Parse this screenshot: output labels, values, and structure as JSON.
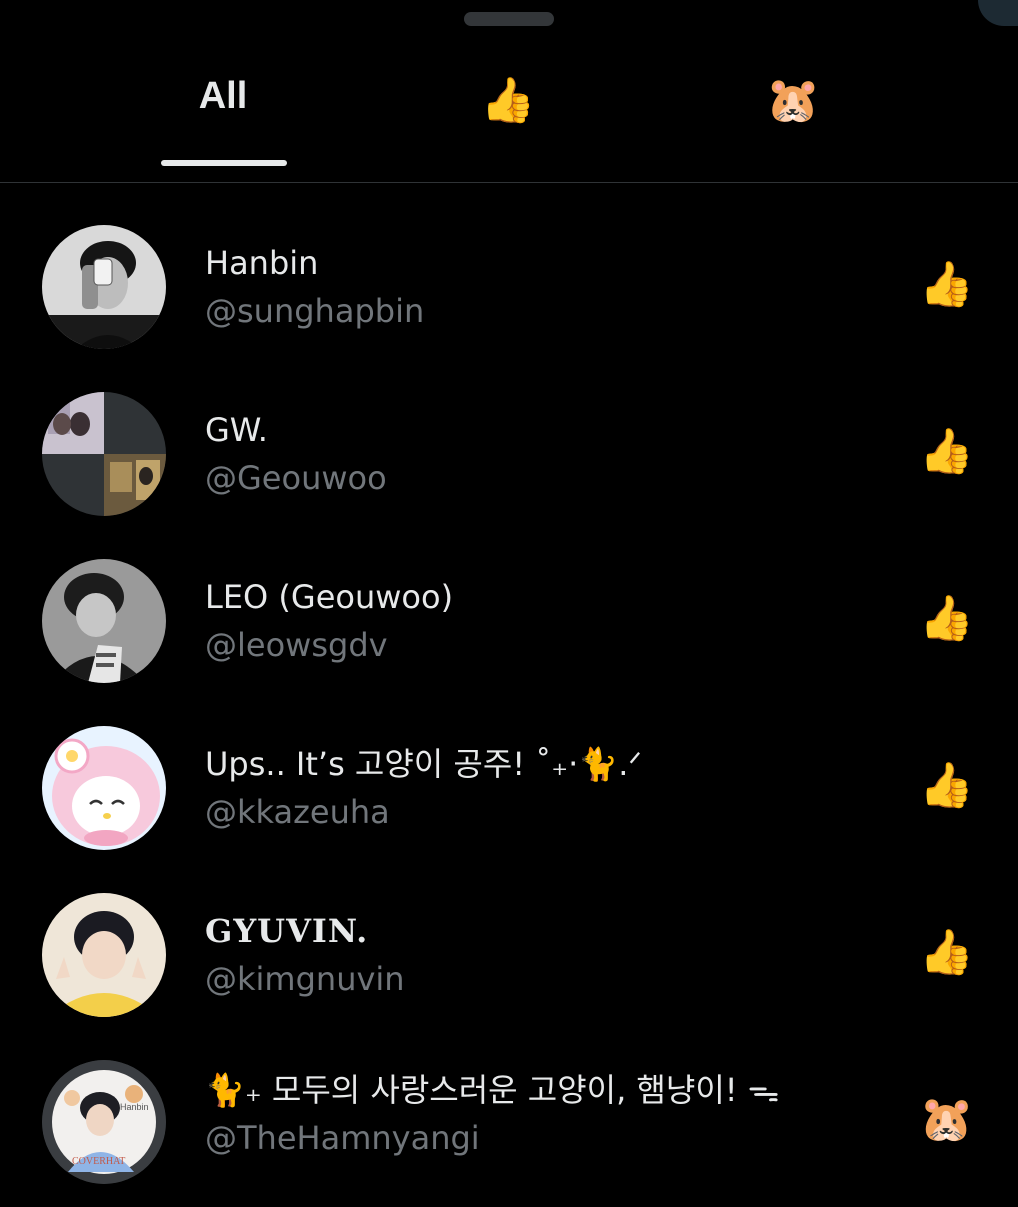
{
  "tabs": [
    {
      "label": "All",
      "type": "text",
      "selected": true
    },
    {
      "label": "👍",
      "type": "emoji",
      "selected": false
    },
    {
      "label": "🐹",
      "type": "emoji",
      "selected": false
    }
  ],
  "reactions": [
    {
      "display_name": "Hanbin",
      "handle": "@sunghapbin",
      "reaction": "👍"
    },
    {
      "display_name": "GW.",
      "handle": "@Geouwoo",
      "reaction": "👍"
    },
    {
      "display_name": "LEO (Geouwoo)",
      "handle": "@leowsgdv",
      "reaction": "👍"
    },
    {
      "display_name": "Ups.. It’s 고양이 공주! ˚₊‧🐈.ᐟ",
      "handle": "@kkazeuha",
      "reaction": "👍"
    },
    {
      "display_name": "GYUVIN.",
      "handle": "@kimgnuvin",
      "reaction": "👍"
    },
    {
      "display_name": "🐈₊ 모두의 사랑스러운 고양이, 햄냥이! ᯓ",
      "handle": "@TheHamnyangi",
      "reaction": "🐹"
    }
  ],
  "avatar_texts": {
    "hamnyangi_name": "Hanbin",
    "hamnyangi_cover": "COVERHAT"
  },
  "colors": {
    "background": "#000000",
    "primary_text": "#e7e9ea",
    "secondary_text": "#71767b",
    "divider": "#2f3336"
  }
}
